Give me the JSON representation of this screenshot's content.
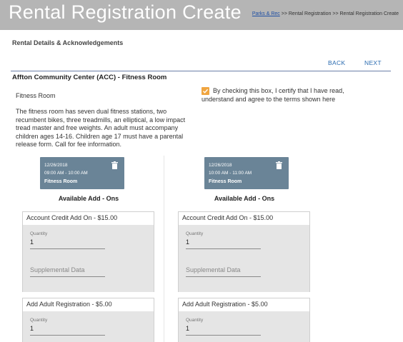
{
  "header": {
    "title": "Rental Registration Create",
    "breadcrumb": {
      "link": "Parks & Rec",
      "separator": ">>",
      "items": [
        "Rental Registration",
        "Rental Registration Create"
      ]
    }
  },
  "section": {
    "title": "Rental Details & Acknowledgements"
  },
  "nav": {
    "back_label": "BACK",
    "next_label": "NEXT"
  },
  "facility": {
    "name": "Affton Community Center (ACC) - Fitness Room",
    "room": "Fitness Room",
    "description": "The fitness room has seven dual fitness stations, two recumbent bikes, three treadmills, an elliptical, a low impact tread master and free weights. An adult must accompany children ages 14-16. Children age 17 must have a parental release form. Call for fee information."
  },
  "acknowledgement": {
    "checked": true,
    "text": "By checking this box, I certify that I have read, understand and agree to the terms shown here",
    "accent": "#f0a540"
  },
  "slots": [
    {
      "date": "12/26/2018",
      "time": "09:00 AM - 10:00 AM",
      "room": "Fitness Room",
      "addons_heading": "Available Add - Ons",
      "addons": [
        {
          "name": "Account Credit Add On - $15.00",
          "quantity_label": "Quantity",
          "quantity": "1",
          "supplemental_placeholder": "Supplemental Data"
        },
        {
          "name": "Add Adult Registration - $5.00",
          "quantity_label": "Quantity",
          "quantity": "1"
        }
      ]
    },
    {
      "date": "12/26/2018",
      "time": "10:00 AM - 11:00 AM",
      "room": "Fitness Room",
      "addons_heading": "Available Add - Ons",
      "addons": [
        {
          "name": "Account Credit Add On - $15.00",
          "quantity_label": "Quantity",
          "quantity": "1",
          "supplemental_placeholder": "Supplemental Data"
        },
        {
          "name": "Add Adult Registration - $5.00",
          "quantity_label": "Quantity",
          "quantity": "1"
        }
      ]
    }
  ],
  "colors": {
    "header_bg": "#b5b5b5",
    "slot_card_bg": "#6a8497",
    "link": "#2a6bb0"
  }
}
